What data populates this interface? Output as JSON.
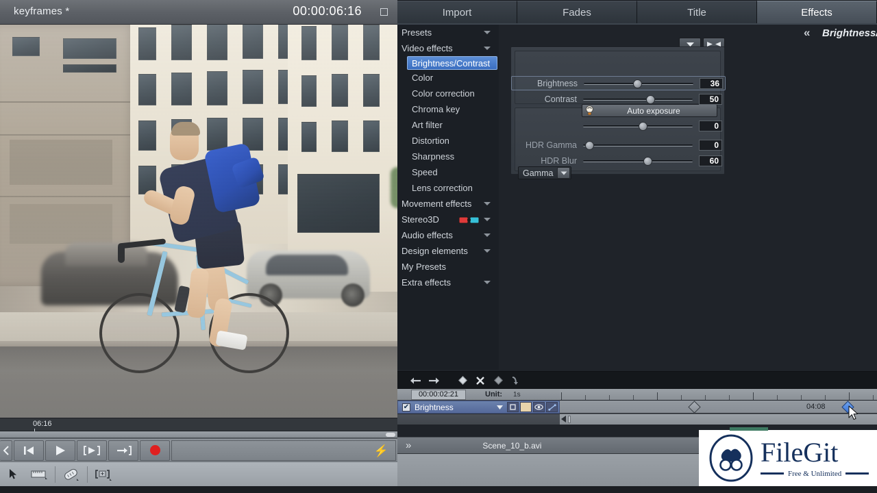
{
  "preview": {
    "title": "keyframes *",
    "timecode": "00:00:06:16",
    "restore_name": "restore-window",
    "scrub_marker": "06:16"
  },
  "transport": {
    "prev_frame": "◀",
    "play": "▶",
    "play_area": "[▶]",
    "to_end": "→]",
    "record": "●",
    "bolt": "⚡"
  },
  "tabs": [
    {
      "label": "Import",
      "active": false
    },
    {
      "label": "Fades",
      "active": false
    },
    {
      "label": "Title",
      "active": false
    },
    {
      "label": "Effects",
      "active": true
    }
  ],
  "effects_tree": [
    {
      "label": "Presets",
      "type": "group",
      "expandable": true,
      "selected": false
    },
    {
      "label": "Video effects",
      "type": "group",
      "expandable": true,
      "selected": false
    },
    {
      "label": "Brightness/Contrast",
      "type": "child",
      "expandable": false,
      "selected": true
    },
    {
      "label": "Color",
      "type": "child",
      "expandable": false,
      "selected": false
    },
    {
      "label": "Color correction",
      "type": "child",
      "expandable": false,
      "selected": false
    },
    {
      "label": "Chroma key",
      "type": "child",
      "expandable": false,
      "selected": false
    },
    {
      "label": "Art filter",
      "type": "child",
      "expandable": false,
      "selected": false
    },
    {
      "label": "Distortion",
      "type": "child",
      "expandable": false,
      "selected": false
    },
    {
      "label": "Sharpness",
      "type": "child",
      "expandable": false,
      "selected": false
    },
    {
      "label": "Speed",
      "type": "child",
      "expandable": false,
      "selected": false
    },
    {
      "label": "Lens correction",
      "type": "child",
      "expandable": false,
      "selected": false
    },
    {
      "label": "Movement effects",
      "type": "group",
      "expandable": true,
      "selected": false
    },
    {
      "label": "Stereo3D",
      "type": "group",
      "expandable": true,
      "selected": false,
      "icon": "3d-glasses-icon"
    },
    {
      "label": "Audio effects",
      "type": "group",
      "expandable": true,
      "selected": false
    },
    {
      "label": "Design elements",
      "type": "group",
      "expandable": true,
      "selected": false
    },
    {
      "label": "My Presets",
      "type": "group",
      "expandable": false,
      "selected": false
    },
    {
      "label": "Extra effects",
      "type": "group",
      "expandable": true,
      "selected": false
    }
  ],
  "detail": {
    "collapse_glyph": "«",
    "title": "Brightness/Contrast",
    "mini_down": "▼",
    "mini_collapse": "▶◀",
    "auto_exposure_label": "Auto exposure",
    "auto_exposure_icon": "lightbulb-icon"
  },
  "parameters": [
    {
      "name": "Brightness",
      "value": "36",
      "knob_pct": 48,
      "dim": false,
      "highlight": true
    },
    {
      "name": "Contrast",
      "value": "50",
      "knob_pct": 60,
      "dim": false,
      "highlight": false
    },
    {
      "name": "HDR Gamma",
      "value": "0",
      "knob_pct": 3,
      "dim": true,
      "highlight": false
    },
    {
      "name": "HDR Blur",
      "value": "60",
      "knob_pct": 55,
      "dim": true,
      "highlight": false
    }
  ],
  "gamma": {
    "selected": "Gamma",
    "value": "0",
    "knob_pct": 54,
    "arrow": "▼"
  },
  "keyframe_toolbar": [
    {
      "name": "prev-keyframe-icon",
      "glyph": "←"
    },
    {
      "name": "next-keyframe-icon",
      "glyph": "→"
    },
    {
      "name": "add-keyframe-icon",
      "glyph": "◆"
    },
    {
      "name": "delete-keyframe-icon",
      "glyph": "✖"
    },
    {
      "name": "keyframe-type-icon",
      "glyph": "◆"
    },
    {
      "name": "curve-icon",
      "glyph": "⤳"
    }
  ],
  "timeline": {
    "timecode": "00:00:02:21",
    "unit_label": "Unit:",
    "unit_value": "1s",
    "track_name": "Brightness",
    "track_checked": "✔",
    "header_icons": [
      "mute-icon",
      "color-swatch",
      "eye-icon",
      "curve-icon"
    ],
    "keyframe_label": "04:08",
    "keyframes": [
      {
        "position_pct": 44,
        "state": "inactive"
      },
      {
        "position_pct": 95,
        "state": "active"
      }
    ],
    "playhead_pct": 56
  },
  "scene": {
    "chevron": "»",
    "filename": "Scene_10_b.avi"
  },
  "watermark": {
    "title": "FileGit",
    "subtitle": "Free & Unlimited"
  },
  "colors": {
    "accent_blue": "#3a6ec0",
    "playhead_orange": "#e4641c",
    "record_red": "#e02020",
    "panel_dark": "#1f2329",
    "watermark_navy": "#15305c"
  }
}
